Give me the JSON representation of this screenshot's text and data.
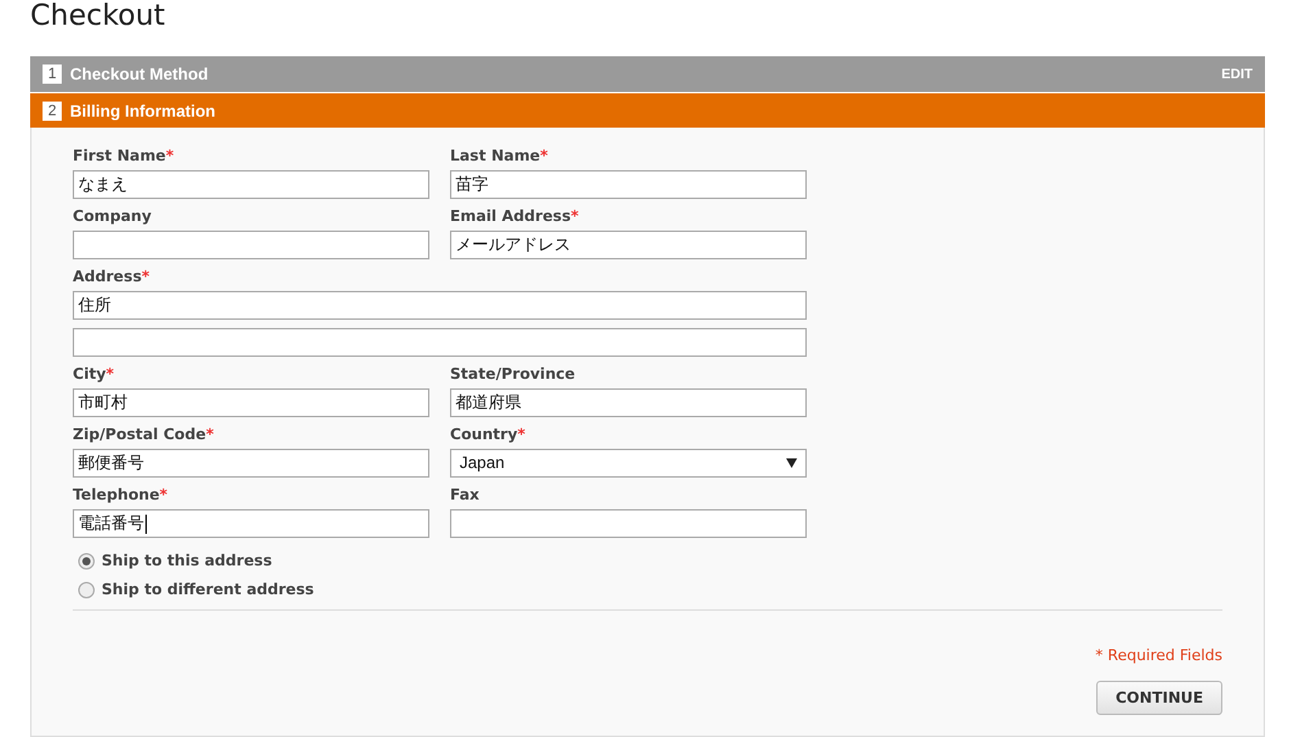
{
  "title": "Checkout",
  "steps": [
    {
      "number": "1",
      "title": "Checkout Method",
      "selected": false,
      "action": "EDIT"
    },
    {
      "number": "2",
      "title": "Billing Information",
      "selected": true
    }
  ],
  "rows": [
    {
      "fields": [
        {
          "kind": "text",
          "label": "First Name",
          "required_mark": "*",
          "value": "なまえ",
          "focused": false
        },
        {
          "kind": "text",
          "label": "Last Name",
          "required_mark": "*",
          "value": "苗字",
          "focused": false
        }
      ]
    },
    {
      "fields": [
        {
          "kind": "text",
          "label": "Company",
          "focused": false
        },
        {
          "kind": "text",
          "label": "Email Address",
          "required_mark": "*",
          "value": "メールアドレス",
          "focused": false
        }
      ]
    },
    {
      "fields": [
        {
          "kind": "address",
          "label": "Address",
          "required_mark": "*",
          "value": "住所",
          "focused": false
        }
      ]
    },
    {
      "fields": [
        {
          "kind": "text",
          "label": "City",
          "required_mark": "*",
          "value": "市町村",
          "focused": false
        },
        {
          "kind": "text",
          "label": "State/Province",
          "value": "都道府県",
          "focused": false
        }
      ]
    },
    {
      "fields": [
        {
          "kind": "text",
          "label": "Zip/Postal Code",
          "required_mark": "*",
          "value": "郵便番号",
          "focused": false
        },
        {
          "kind": "select",
          "label": "Country",
          "required_mark": "*",
          "value": "Japan"
        }
      ]
    },
    {
      "fields": [
        {
          "kind": "text",
          "label": "Telephone",
          "required_mark": "*",
          "value": "電話番号",
          "focused": true
        },
        {
          "kind": "text",
          "label": "Fax",
          "focused": false
        }
      ]
    }
  ],
  "shipping_options": [
    {
      "label": "Ship to this address",
      "selected": true
    },
    {
      "label": "Ship to different address",
      "selected": false
    }
  ],
  "required_note": "* Required Fields",
  "continue_button": "CONTINUE"
}
